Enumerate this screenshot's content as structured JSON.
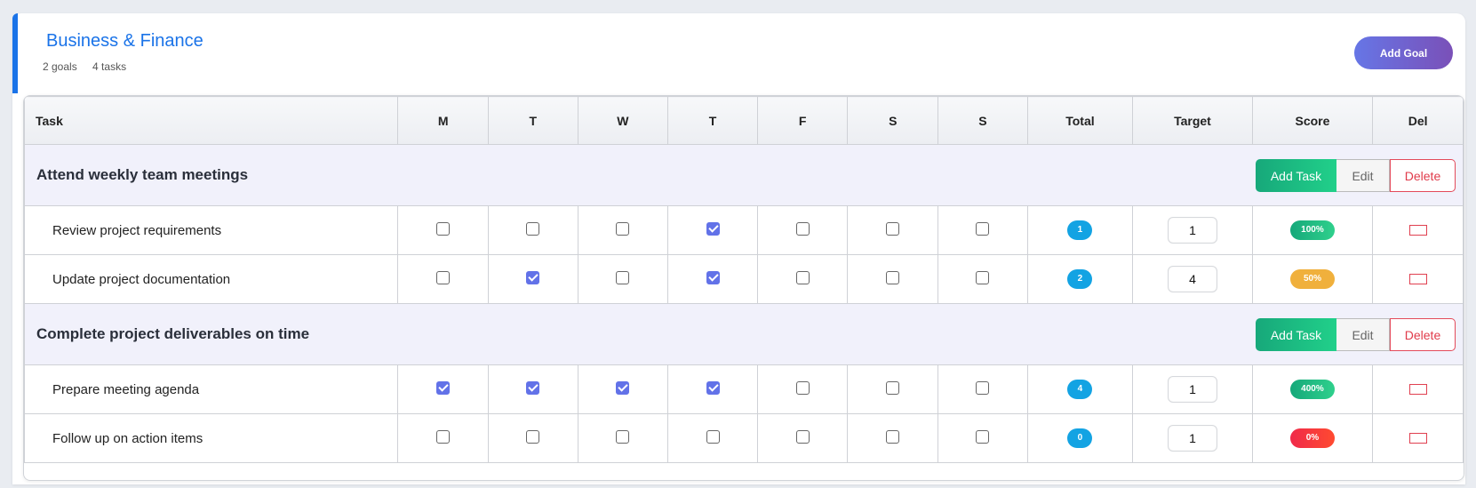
{
  "category": {
    "title": "Business & Finance",
    "goals_count": "2 goals",
    "tasks_count": "4 tasks",
    "add_goal_label": "Add Goal"
  },
  "table": {
    "headers": [
      "Task",
      "M",
      "T",
      "W",
      "T",
      "F",
      "S",
      "S",
      "Total",
      "Target",
      "Score",
      "Del"
    ]
  },
  "goal_buttons": {
    "add_task": "Add Task",
    "edit": "Edit",
    "delete": "Delete"
  },
  "goals": [
    {
      "title": "Attend weekly team meetings",
      "tasks": [
        {
          "name": "Review project requirements",
          "days": [
            false,
            false,
            false,
            true,
            false,
            false,
            false
          ],
          "total": "1",
          "target": "1",
          "score": "100%",
          "score_color": "#1fbe84"
        },
        {
          "name": "Update project documentation",
          "days": [
            false,
            true,
            false,
            true,
            false,
            false,
            false
          ],
          "total": "2",
          "target": "4",
          "score": "50%",
          "score_color": "#f0b03c"
        }
      ]
    },
    {
      "title": "Complete project deliverables on time",
      "tasks": [
        {
          "name": "Prepare meeting agenda",
          "days": [
            true,
            true,
            true,
            true,
            false,
            false,
            false
          ],
          "total": "4",
          "target": "1",
          "score": "400%",
          "score_color": "#1fbe84"
        },
        {
          "name": "Follow up on action items",
          "days": [
            false,
            false,
            false,
            false,
            false,
            false,
            false
          ],
          "total": "0",
          "target": "1",
          "score": "0%",
          "score_color": "#f5333f"
        }
      ]
    }
  ],
  "colors": {
    "accent": "#1a73e8",
    "checkbox_checked": "#6272e8",
    "total_badge": "#13a3e3",
    "delete_red": "#e03a4a"
  }
}
